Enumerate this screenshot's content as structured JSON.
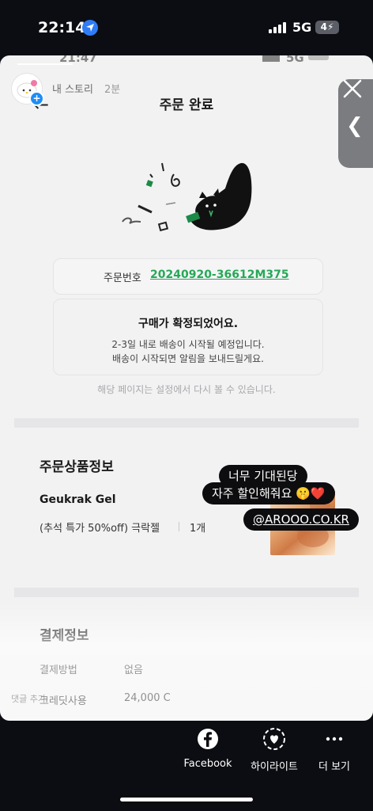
{
  "status_bar": {
    "time": "22:14",
    "network": "5G",
    "battery": "4"
  },
  "story": {
    "ghost_status_time": "21:47",
    "ghost_status_network": "5G",
    "user": "내 스토리",
    "posted_ago": "2분",
    "screenshot": {
      "title": "주문 완료",
      "order_number_label": "주문번호",
      "order_number": "20240920-36612M375",
      "confirm_title": "구매가 확정되었어요.",
      "confirm_line1": "2-3일 내로 배송이 시작될 예정입니다.",
      "confirm_line2": "배송이 시작되면 알림을 보내드릴게요.",
      "note": "해당 페이지는 설정에서 다시 볼 수 있습니다.",
      "product_section_title": "주문상품정보",
      "product_name": "Geukrak Gel",
      "product_option": "(추석 특가 50%off) 극락젤",
      "product_quantity": "1개",
      "payment_section_title": "결제정보",
      "payment_method_label": "결제방법",
      "payment_method_value": "없음",
      "credit_label": "크레딧사용",
      "credit_value": "24,000 C",
      "comment_ghost": "댓글 추가"
    },
    "stickers": {
      "line1": "너무 기대된당",
      "line2": "자주 할인해줘요 🤫❤️",
      "mention": "@AROOO.CO.KR"
    }
  },
  "actions": {
    "facebook": "Facebook",
    "highlight": "하이라이트",
    "more": "더 보기"
  },
  "colors": {
    "background": "#0b0d12",
    "order_number_green": "#26a857",
    "location_blue": "#2f7cf6",
    "avatar_plus_blue": "#1f8df5"
  }
}
